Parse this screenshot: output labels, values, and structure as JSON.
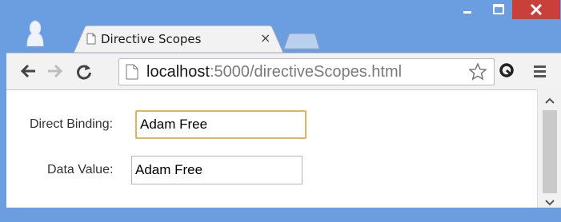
{
  "browser": {
    "tab": {
      "title": "Directive Scopes",
      "close_glyph": "×"
    },
    "address_bar": {
      "host": "localhost",
      "rest": ":5000/directiveScopes.html"
    },
    "icons": {
      "back": "back-arrow-icon",
      "forward": "forward-arrow-icon",
      "reload": "reload-icon",
      "page": "page-icon",
      "bookmark": "star-icon",
      "extension": "extension-icon",
      "menu": "hamburger-menu-icon"
    },
    "colors": {
      "frame": "#6a9ee0",
      "close_button": "#c9403a",
      "focus_border": "#e2b35a"
    }
  },
  "form": {
    "direct_binding": {
      "label": "Direct Binding:",
      "value": "Adam Free"
    },
    "data_value": {
      "label": "Data Value:",
      "value": "Adam Free"
    }
  }
}
